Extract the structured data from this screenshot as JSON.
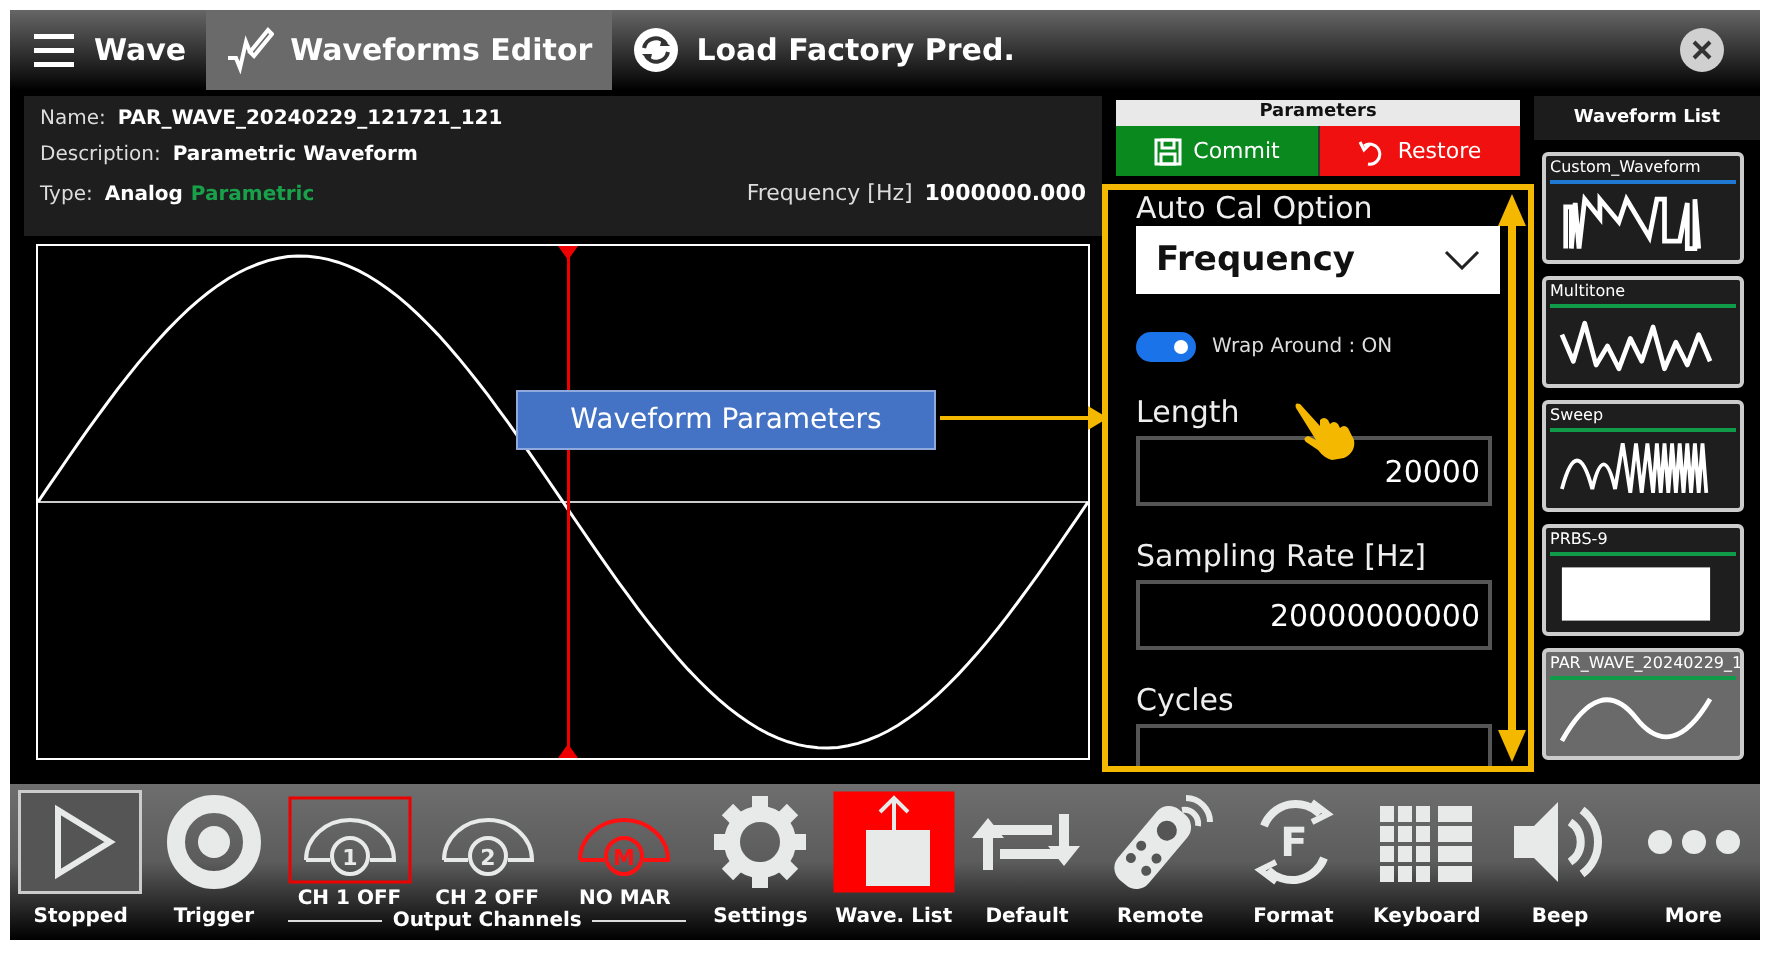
{
  "top_bar": {
    "tabs": [
      {
        "label": "Wave",
        "kind": "menu",
        "selected": false
      },
      {
        "label": "Waveforms Editor",
        "kind": "editor",
        "selected": true
      },
      {
        "label": "Load Factory Pred.",
        "kind": "reload",
        "selected": false
      }
    ]
  },
  "info": {
    "name_label": "Name:",
    "name": "PAR_WAVE_20240229_121721_121",
    "description_label": "Description:",
    "description": "Parametric Waveform",
    "type_label": "Type:",
    "type": "Analog",
    "subtype": "Parametric",
    "frequency_label": "Frequency [Hz]",
    "frequency": "1000000.000"
  },
  "callout": {
    "label": "Waveform Parameters"
  },
  "parameters": {
    "title": "Parameters",
    "commit": "Commit",
    "restore": "Restore",
    "fields": [
      {
        "kind": "dropdown",
        "label": "Auto Cal Option",
        "value": "Frequency"
      },
      {
        "kind": "toggle",
        "label": "Wrap Around : ON",
        "on": true
      },
      {
        "kind": "number",
        "label": "Length",
        "value": "20000"
      },
      {
        "kind": "number",
        "label": "Sampling Rate [Hz]",
        "value": "20000000000"
      },
      {
        "kind": "number",
        "label": "Cycles"
      }
    ]
  },
  "waveform_list": {
    "title": "Waveform List",
    "items": [
      {
        "label": "Custom_Waveform",
        "kind": "custom",
        "color": "#1f78d1",
        "selected": false
      },
      {
        "label": "Multitone",
        "kind": "multitone",
        "color": "#109b48",
        "selected": false
      },
      {
        "label": "Sweep",
        "kind": "sweep",
        "color": "#109b48",
        "selected": false
      },
      {
        "label": "PRBS-9",
        "kind": "prbs",
        "color": "#109b48",
        "selected": false
      },
      {
        "label": "PAR_WAVE_20240229_1",
        "kind": "sine",
        "color": "#109b48",
        "selected": true
      }
    ]
  },
  "toolbar": {
    "items": [
      {
        "kind": "play",
        "label": "Stopped",
        "selected": true,
        "highlighted": false
      },
      {
        "kind": "trigger",
        "label": "Trigger",
        "selected": false,
        "highlighted": false
      },
      {
        "kind": "group",
        "label": "Output Channels",
        "channels": [
          {
            "number": "1",
            "label": "CH 1 OFF",
            "selected": true,
            "alert": false
          },
          {
            "number": "2",
            "label": "CH 2 OFF",
            "selected": false,
            "alert": false
          },
          {
            "number": "M",
            "label": "NO MAR",
            "selected": false,
            "alert": true
          }
        ]
      },
      {
        "kind": "gear",
        "label": "Settings",
        "selected": false,
        "highlighted": false
      },
      {
        "kind": "upload",
        "label": "Wave. List",
        "selected": false,
        "highlighted": true
      },
      {
        "kind": "repeat",
        "label": "Default",
        "selected": false,
        "highlighted": false
      },
      {
        "kind": "remote",
        "label": "Remote",
        "selected": false,
        "highlighted": false
      },
      {
        "kind": "format",
        "label": "Format",
        "glyph": "F",
        "selected": false,
        "highlighted": false
      },
      {
        "kind": "keyboard",
        "label": "Keyboard",
        "selected": false,
        "highlighted": false
      },
      {
        "kind": "speaker",
        "label": "Beep",
        "selected": false,
        "highlighted": false
      },
      {
        "kind": "dots",
        "label": "More",
        "selected": false,
        "highlighted": false
      }
    ]
  }
}
